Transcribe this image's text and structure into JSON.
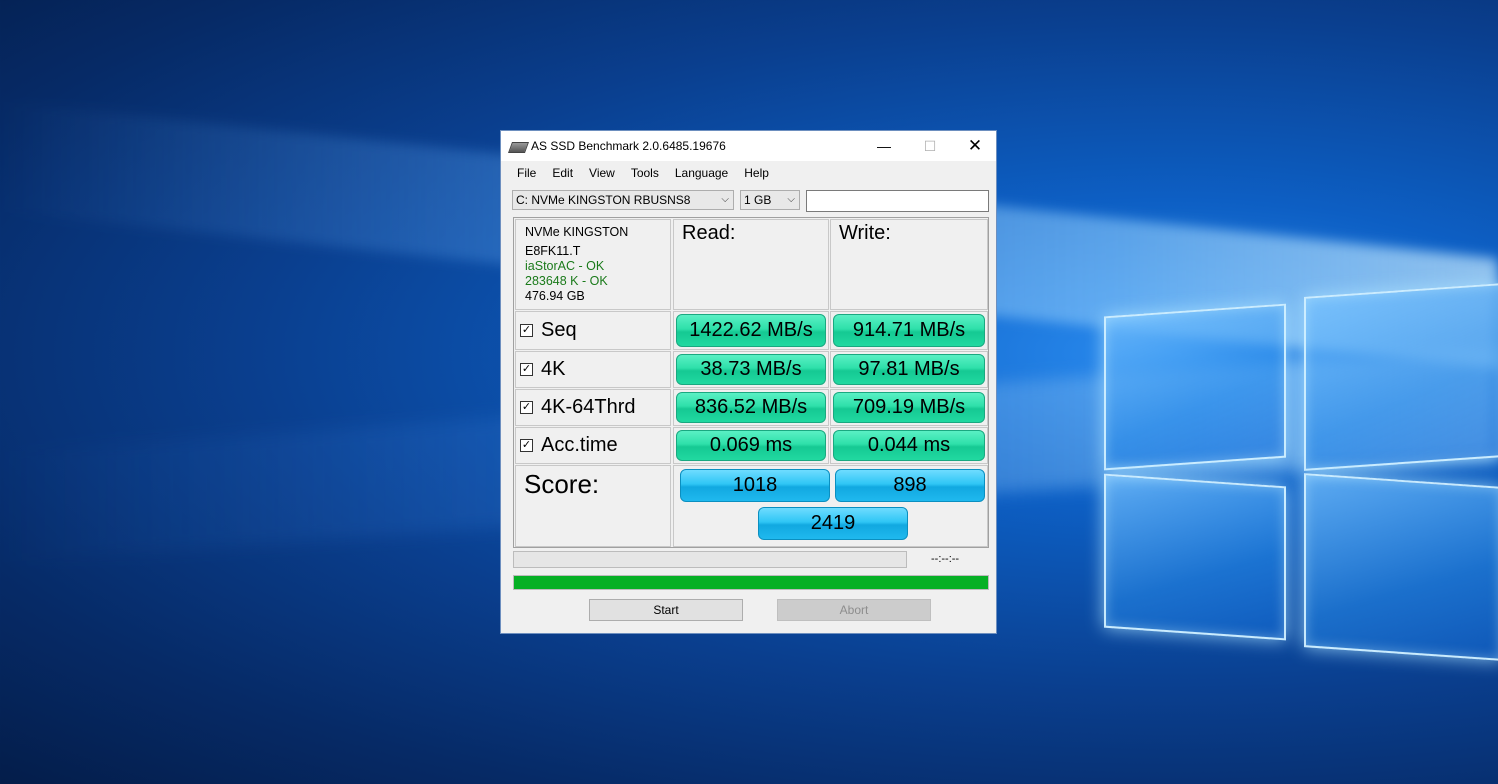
{
  "window": {
    "title": "AS SSD Benchmark 2.0.6485.19676",
    "controls": {
      "minimize": "—",
      "maximize": "☐",
      "close": "✕"
    }
  },
  "menu": [
    "File",
    "Edit",
    "View",
    "Tools",
    "Language",
    "Help"
  ],
  "toolbar": {
    "drive_select": "C: NVMe KINGSTON RBUSNS8",
    "size_select": "1 GB",
    "textbox_value": ""
  },
  "drive_info": {
    "model": "NVMe KINGSTON",
    "firmware": "E8FK11.T",
    "driver_status": "iaStorAC - OK",
    "alignment_status": "283648 K - OK",
    "capacity": "476.94 GB"
  },
  "headers": {
    "read": "Read:",
    "write": "Write:"
  },
  "rows": [
    {
      "label": "Seq",
      "checked": "☑",
      "read": "1422.62 MB/s",
      "write": "914.71 MB/s"
    },
    {
      "label": "4K",
      "checked": "☑",
      "read": "38.73 MB/s",
      "write": "97.81 MB/s"
    },
    {
      "label": "4K-64Thrd",
      "checked": "☑",
      "read": "836.52 MB/s",
      "write": "709.19 MB/s"
    },
    {
      "label": "Acc.time",
      "checked": "☑",
      "read": "0.069 ms",
      "write": "0.044 ms"
    }
  ],
  "score": {
    "label": "Score:",
    "read": "1018",
    "write": "898",
    "total": "2419"
  },
  "progress": {
    "timer": "--:--:--",
    "overall_fraction": 1.0
  },
  "buttons": {
    "start": "Start",
    "abort": "Abort"
  },
  "colors": {
    "result_pill": "#2ee0aa",
    "score_pill": "#2fc6f5",
    "progress_fill": "#06b025"
  },
  "icons": {
    "app": "ssd-drive-icon",
    "dropdown": "chevron-down-icon"
  }
}
